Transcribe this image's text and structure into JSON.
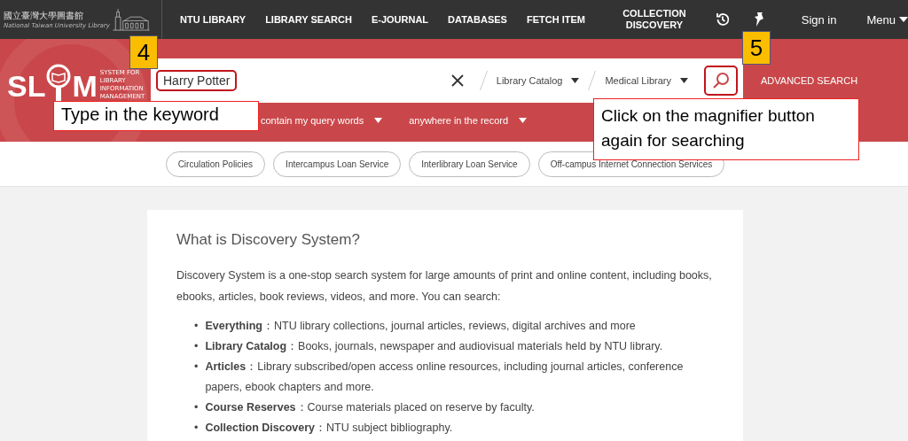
{
  "top_bar": {
    "logo": {
      "chinese": "國立臺灣大學圖書館",
      "english": "National Taiwan University Library"
    },
    "nav": [
      "NTU LIBRARY",
      "LIBRARY SEARCH",
      "E-JOURNAL",
      "DATABASES",
      "FETCH ITEM",
      "COLLECTION DISCOVERY"
    ],
    "sign_in": "Sign in",
    "menu": "Menu"
  },
  "search": {
    "logo": {
      "before": "SL",
      "after": "M",
      "subtitle": [
        "SYSTEM FOR",
        "LIBRARY",
        "INFORMATION",
        "MANAGEMENT"
      ]
    },
    "value": "Harry Potter",
    "scope": "Library Catalog",
    "library": "Medical Library",
    "advanced": "ADVANCED SEARCH",
    "filters": [
      "contain my query words",
      "anywhere in the record"
    ]
  },
  "quick_links": [
    "Circulation Policies",
    "Intercampus Loan Service",
    "Interlibrary Loan Service",
    "Off-campus Internet Connection Services"
  ],
  "content": {
    "title": "What is Discovery System?",
    "intro": "Discovery System is a one-stop search system for large amounts of print and online content, including books, ebooks, articles, book reviews, videos, and more. You can search:",
    "items": [
      {
        "bullet": "•",
        "text": "**Everything**：NTU library collections, journal articles, reviews, digital archives and more"
      },
      {
        "bullet": "•",
        "text": "**Library Catalog**：Books, journals, newspaper and audiovisual materials held by NTU library."
      },
      {
        "bullet": "•",
        "text": "**Articles**：Library subscribed/open access online resources, including journal articles, conference papers, ebook chapters and more."
      },
      {
        "bullet": "•",
        "text": "**Course Reserves**：Course materials placed on reserve by faculty."
      },
      {
        "bullet": "•",
        "text": "**Collection Discovery**：NTU subject bibliography."
      }
    ]
  },
  "annotations": [
    {
      "step": "4",
      "note": "Type in the keyword"
    },
    {
      "step": "5",
      "note": "Click on the magnifier button again for searching"
    }
  ]
}
